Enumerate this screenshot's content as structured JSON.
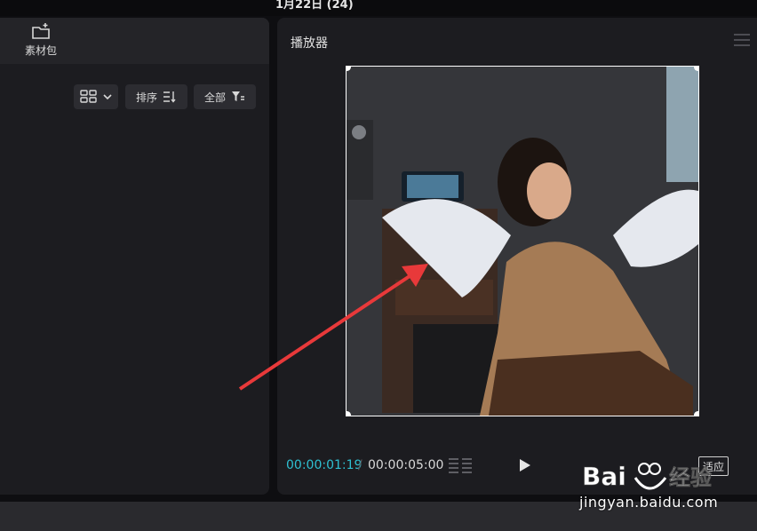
{
  "window": {
    "top_title": "1月22日 (24)"
  },
  "left_panel": {
    "asset_tab": {
      "label": "素材包",
      "icon": "folder-add-icon"
    },
    "toolbar": {
      "view_mode_icon": "grid-view-icon",
      "sort_label": "排序",
      "filter_label": "全部"
    }
  },
  "player": {
    "title": "播放器",
    "current_time": "00:00:01:19",
    "separator": "/",
    "total_time": "00:00:05:00",
    "fit_label": "适应",
    "accent_color": "#2ec0d2"
  },
  "watermark": {
    "brand": "Bai经验",
    "url": "jingyan.baidu.com"
  },
  "annotation": {
    "color": "#e8393a"
  }
}
